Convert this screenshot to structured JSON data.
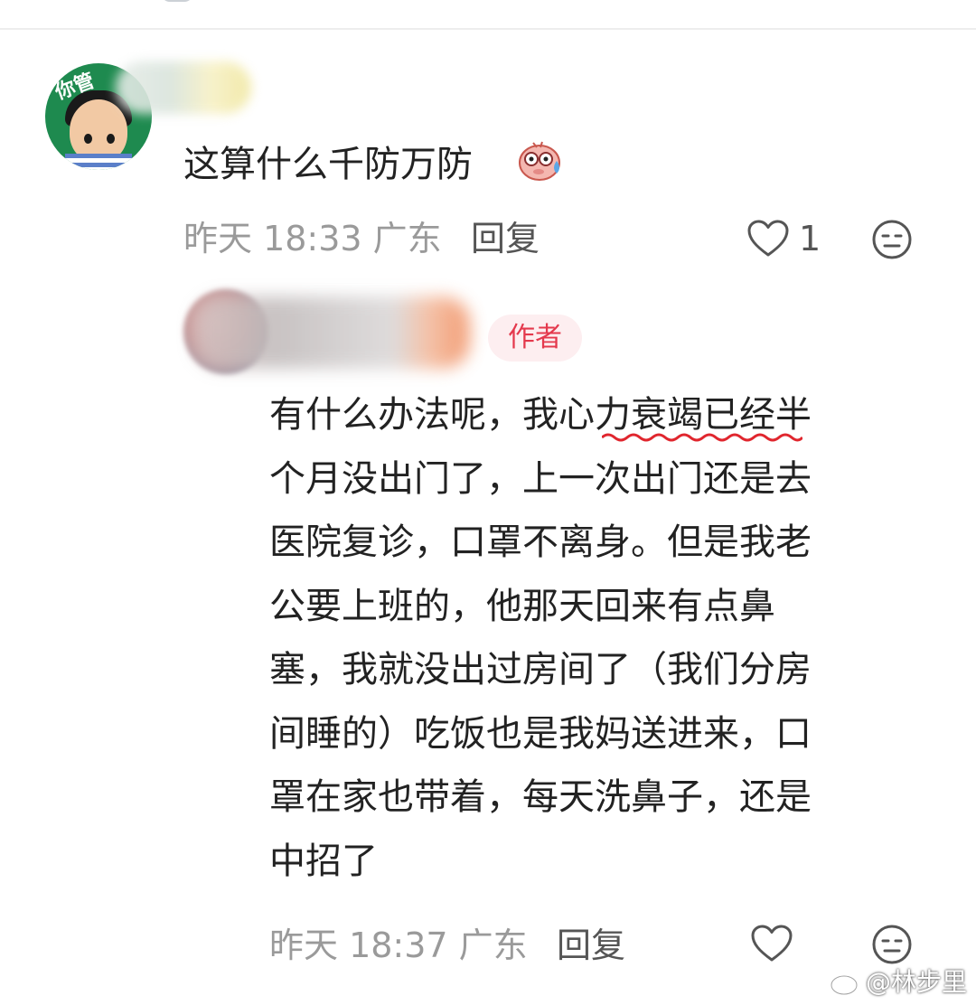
{
  "comment1": {
    "avatar_text": "你管",
    "text": "这算什么千防万防",
    "emoji": "sweat-pig-emoji",
    "meta": "昨天 18:33 广东",
    "reply_label": "回复",
    "likes": "1"
  },
  "comment2": {
    "badge": "作者",
    "lines": [
      "有什么办法呢，我心力衰竭已经半",
      "个月没出门了，上一次出门还是去",
      "医院复诊，口罩不离身。但是我老",
      "公要上班的，他那天回来有点鼻",
      "塞，我就没出过房间了（我们分房",
      "间睡的）吃饭也是我妈送进来，口",
      "罩在家也带着，每天洗鼻子，还是",
      "中招了"
    ],
    "meta": "昨天 18:37 广东",
    "reply_label": "回复"
  },
  "watermark": {
    "text": "@林步里",
    "icon": "weibo-icon"
  },
  "colors": {
    "meta_gray": "#9a9a9a",
    "author_badge_text": "#e4394d",
    "author_badge_bg": "#fdeef0",
    "squiggle_red": "#e0262e"
  }
}
